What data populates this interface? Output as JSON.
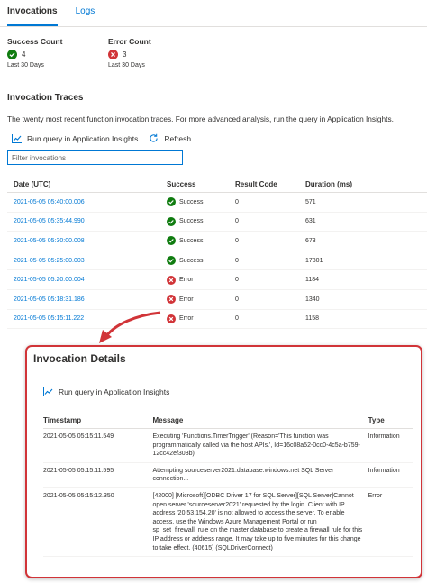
{
  "tabs": [
    {
      "label": "Invocations",
      "active": true
    },
    {
      "label": "Logs",
      "active": false
    }
  ],
  "counts": {
    "success": {
      "title": "Success Count",
      "value": "4",
      "period": "Last 30 Days",
      "icon": "check-circle-icon",
      "color": "#107c10"
    },
    "error": {
      "title": "Error Count",
      "value": "3",
      "period": "Last 30 Days",
      "icon": "error-circle-icon",
      "color": "#d13438"
    }
  },
  "traces": {
    "title": "Invocation Traces",
    "description": "The twenty most recent function invocation traces. For more advanced analysis, run the query in Application Insights.",
    "run_query_label": "Run query in Application Insights",
    "refresh_label": "Refresh",
    "filter_placeholder": "Filter invocations",
    "columns": [
      "Date (UTC)",
      "Success",
      "Result Code",
      "Duration (ms)"
    ],
    "rows": [
      {
        "date": "2021-05-05 05:40:00.006",
        "status": "Success",
        "ok": true,
        "code": "0",
        "duration": "571"
      },
      {
        "date": "2021-05-05 05:35:44.990",
        "status": "Success",
        "ok": true,
        "code": "0",
        "duration": "631"
      },
      {
        "date": "2021-05-05 05:30:00.008",
        "status": "Success",
        "ok": true,
        "code": "0",
        "duration": "673"
      },
      {
        "date": "2021-05-05 05:25:00.003",
        "status": "Success",
        "ok": true,
        "code": "0",
        "duration": "17801"
      },
      {
        "date": "2021-05-05 05:20:00.004",
        "status": "Error",
        "ok": false,
        "code": "0",
        "duration": "1184"
      },
      {
        "date": "2021-05-05 05:18:31.186",
        "status": "Error",
        "ok": false,
        "code": "0",
        "duration": "1340"
      },
      {
        "date": "2021-05-05 05:15:11.222",
        "status": "Error",
        "ok": false,
        "code": "0",
        "duration": "1158"
      }
    ]
  },
  "details": {
    "title": "Invocation Details",
    "run_query_label": "Run query in Application Insights",
    "columns": [
      "Timestamp",
      "Message",
      "Type"
    ],
    "rows": [
      {
        "timestamp": "2021-05-05 05:15:11.549",
        "message": "Executing 'Functions.TimerTrigger' (Reason='This function was programmatically called via the host APIs.', Id=16c08a52-0cc0-4c5a-b759-12cc42ef303b)",
        "type": "Information"
      },
      {
        "timestamp": "2021-05-05 05:15:11.595",
        "message": "Attempting sourceserver2021.database.windows.net SQL Server connection...",
        "type": "Information"
      },
      {
        "timestamp": "2021-05-05 05:15:12.350",
        "message": "[42000] [Microsoft][ODBC Driver 17 for SQL Server][SQL Server]Cannot open server 'sourceserver2021' requested by the login. Client with IP address '20.53.154.20' is not allowed to access the server. To enable access, use the Windows Azure Management Portal or run sp_set_firewall_rule on the master database to create a firewall rule for this IP address or address range. It may take up to five minutes for this change to take effect. (40615) (SQLDriverConnect)",
        "type": "Error"
      }
    ]
  },
  "colors": {
    "accent": "#0078d4",
    "success": "#107c10",
    "error": "#d13438",
    "highlight": "#d13438"
  }
}
